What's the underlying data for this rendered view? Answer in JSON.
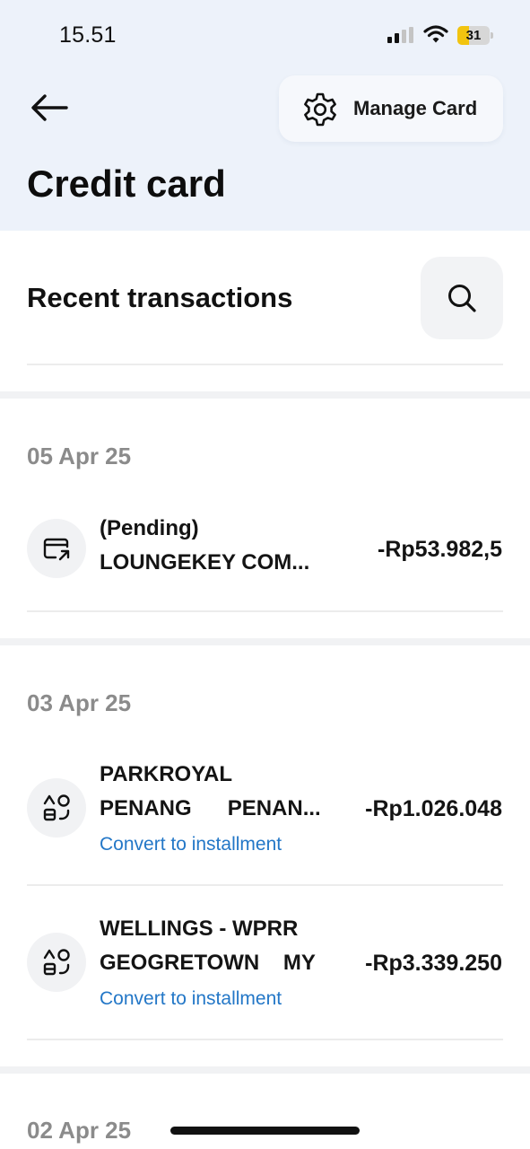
{
  "status_bar": {
    "time": "15.51",
    "battery": "31",
    "battery_color": "#f2c40f"
  },
  "header": {
    "back_icon": "arrow-left-icon",
    "manage_icon": "gear-icon",
    "manage_label": "Manage Card",
    "title": "Credit card"
  },
  "recent": {
    "title": "Recent transactions",
    "search_icon": "search-icon"
  },
  "groups": [
    {
      "date": "05 Apr 25",
      "transactions": [
        {
          "icon": "card-arrow-icon",
          "line1": "(Pending)",
          "line2": "LOUNGEKEY COM...",
          "amount": "-Rp53.982,5"
        }
      ]
    },
    {
      "date": "03 Apr 25",
      "transactions": [
        {
          "icon": "category-shapes-icon",
          "line1": "PARKROYAL",
          "line2": "PENANG      PENAN...",
          "amount": "-Rp1.026.048",
          "action": "Convert to installment"
        },
        {
          "icon": "category-shapes-icon",
          "line1": "WELLINGS - WPRR",
          "line2": "GEOGRETOWN    MY",
          "amount": "-Rp3.339.250",
          "action": "Convert to installment"
        }
      ]
    },
    {
      "date": "02 Apr 25"
    }
  ],
  "colors": {
    "header_bg": "#edf2fa",
    "link": "#2377c7",
    "date": "#8b8b8b"
  }
}
